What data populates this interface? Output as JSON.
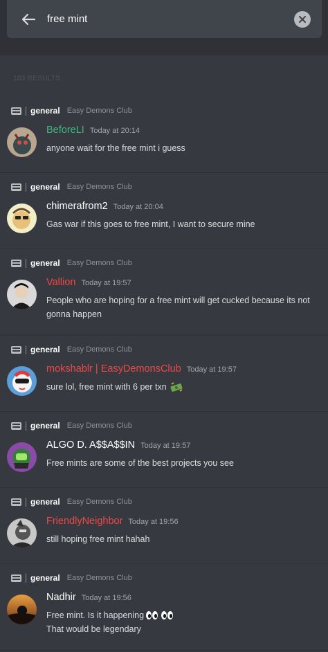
{
  "search": {
    "query": "free mint"
  },
  "results_count": "103 RESULTS",
  "results": [
    {
      "channel": "general",
      "server": "Easy Demons Club",
      "author": "BeforeLI",
      "author_color": "#43b581",
      "timestamp": "Today at 20:14",
      "lines": [
        "anyone wait for the free mint i guess"
      ]
    },
    {
      "channel": "general",
      "server": "Easy Demons Club",
      "author": "chimerafrom2",
      "author_color": "#ffffff",
      "timestamp": "Today at 20:04",
      "lines": [
        "Gas war if this goes to free mint, I want to secure mine"
      ]
    },
    {
      "channel": "general",
      "server": "Easy Demons Club",
      "author": "Vallion",
      "author_color": "#f04747",
      "timestamp": "Today at 19:57",
      "lines": [
        "People who are hoping for a free mint will get cucked because its not",
        "gonna happen"
      ]
    },
    {
      "channel": "general",
      "server": "Easy Demons Club",
      "author": "mokshablr | EasyDemonsClub",
      "author_color": "#f04747",
      "timestamp": "Today at 19:57",
      "lines": [
        "sure lol, free mint with 6 per txn"
      ]
    },
    {
      "channel": "general",
      "server": "Easy Demons Club",
      "author": "ALGO D. A$$A$$IN",
      "author_color": "#ffffff",
      "timestamp": "Today at 19:57",
      "lines": [
        "Free mints are some of the best projects you see"
      ]
    },
    {
      "channel": "general",
      "server": "Easy Demons Club",
      "author": "FriendlyNeighbor",
      "author_color": "#f04747",
      "timestamp": "Today at 19:56",
      "lines": [
        "still hoping free mint hahah"
      ]
    },
    {
      "channel": "general",
      "server": "Easy Demons Club",
      "author": "Nadhir",
      "author_color": "#ffffff",
      "timestamp": "Today at 19:56",
      "lines": [
        "Free mint. Is it happening",
        "That would be legendary"
      ]
    }
  ]
}
